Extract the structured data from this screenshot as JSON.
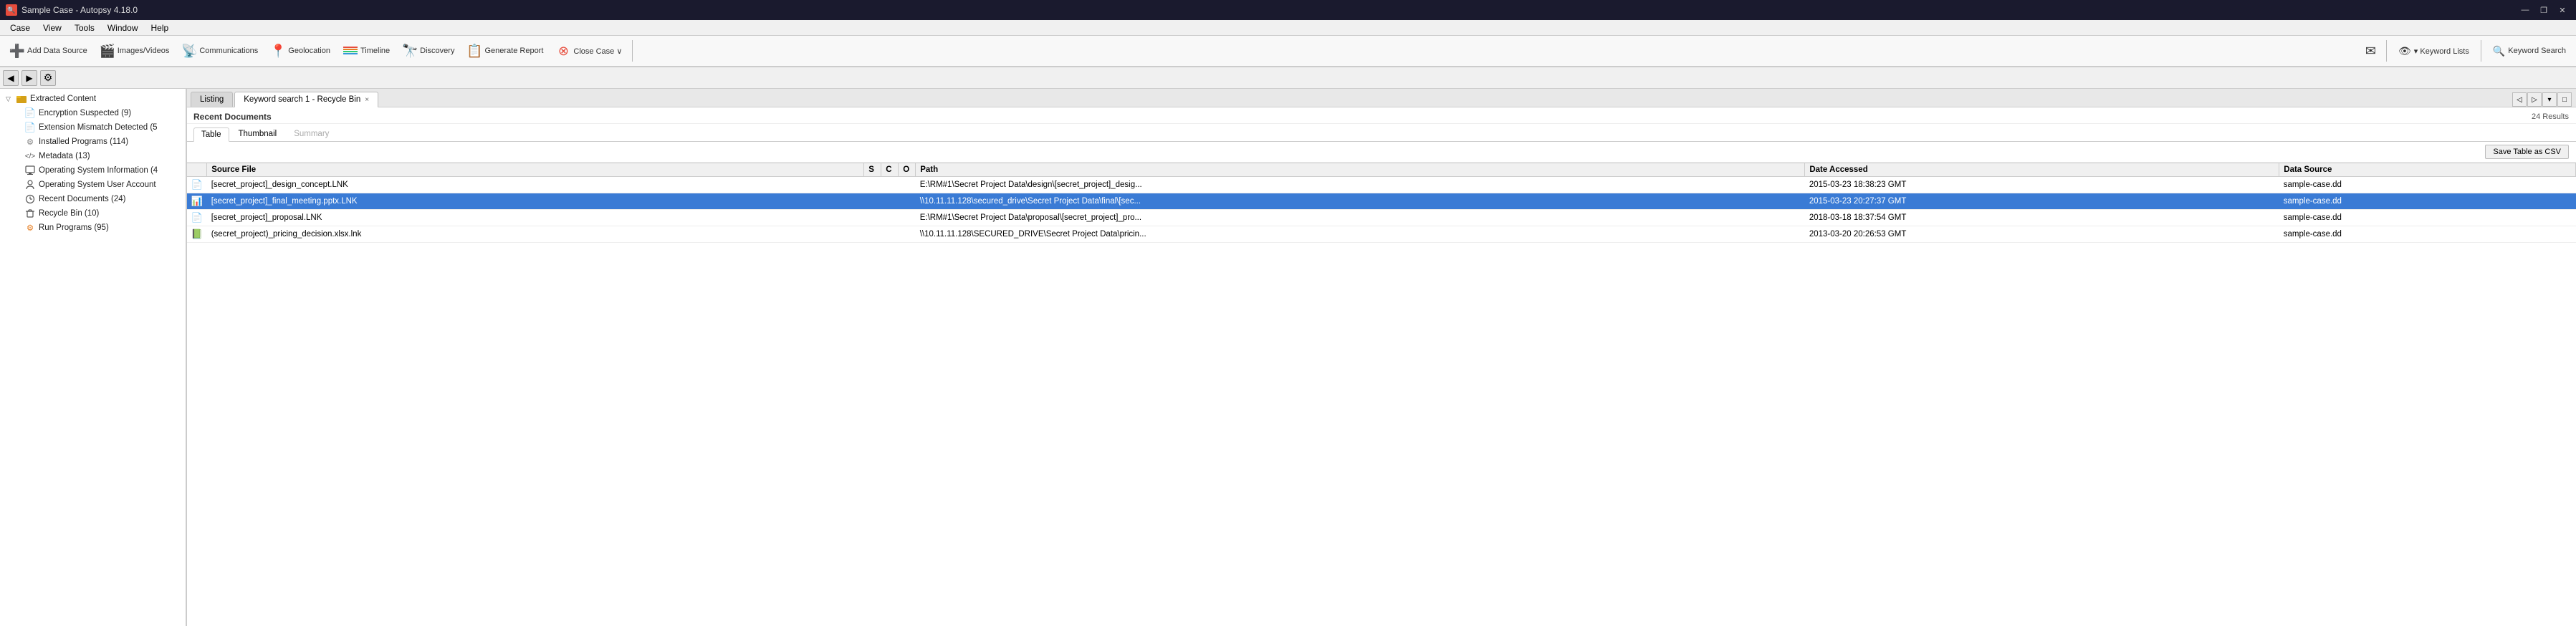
{
  "titleBar": {
    "appName": "Sample Case - Autopsy 4.18.0",
    "icon": "🔍",
    "controls": [
      "—",
      "❐",
      "✕"
    ]
  },
  "menuBar": {
    "items": [
      "Case",
      "View",
      "Tools",
      "Window",
      "Help"
    ]
  },
  "toolbar": {
    "buttons": [
      {
        "id": "add-data-source",
        "label": "Add Data Source",
        "icon": "➕",
        "iconColor": "#2ecc71"
      },
      {
        "id": "images-videos",
        "label": "Images/Videos",
        "icon": "🎬",
        "iconColor": "#3498db"
      },
      {
        "id": "communications",
        "label": "Communications",
        "icon": "📡",
        "iconColor": "#9b59b6"
      },
      {
        "id": "geolocation",
        "label": "Geolocation",
        "icon": "📍",
        "iconColor": "#e74c3c"
      },
      {
        "id": "timeline",
        "label": "Timeline",
        "icon": "📊",
        "iconColor": "#1abc9c"
      },
      {
        "id": "discovery",
        "label": "Discovery",
        "icon": "🔭",
        "iconColor": "#e67e22"
      },
      {
        "id": "generate-report",
        "label": "Generate Report",
        "icon": "📋",
        "iconColor": "#3498db"
      },
      {
        "id": "close-case",
        "label": "Close Case ∨",
        "icon": "⊗",
        "iconColor": "#e74c3c"
      }
    ],
    "rightButtons": [
      {
        "id": "keyword-lists",
        "label": "▾ Keyword Lists",
        "icon": "👁"
      },
      {
        "id": "keyword-search",
        "label": "Keyword Search",
        "icon": "🔍"
      }
    ]
  },
  "navBar": {
    "backLabel": "◀",
    "forwardLabel": "▶",
    "gearLabel": "⚙"
  },
  "tabs": {
    "listing": "Listing",
    "keywordSearch": "Keyword search 1 - Recycle Bin",
    "closeBtn": "×"
  },
  "contentHeader": {
    "sectionTitle": "Recent Documents",
    "resultsCount": "24 Results"
  },
  "subTabs": [
    "Table",
    "Thumbnail",
    "Summary"
  ],
  "activeSubTab": "Table",
  "saveCSVLabel": "Save Table as CSV",
  "tableHeaders": [
    {
      "id": "source-file",
      "label": "Source File"
    },
    {
      "id": "s-col",
      "label": "S"
    },
    {
      "id": "c-col",
      "label": "C"
    },
    {
      "id": "o-col",
      "label": "O"
    },
    {
      "id": "path",
      "label": "Path"
    },
    {
      "id": "date-accessed",
      "label": "Date Accessed"
    },
    {
      "id": "data-source",
      "label": "Data Source"
    }
  ],
  "tableRows": [
    {
      "id": 1,
      "iconType": "doc",
      "sourceFile": "[secret_project]_design_concept.LNK",
      "s": "",
      "c": "",
      "o": "",
      "path": "E:\\RM#1\\Secret Project Data\\design\\[secret_project]_desig...",
      "dateAccessed": "2015-03-23 18:38:23 GMT",
      "dataSource": "sample-case.dd",
      "selected": false
    },
    {
      "id": 2,
      "iconType": "pptx",
      "sourceFile": "[secret_project]_final_meeting.pptx.LNK",
      "s": "",
      "c": "",
      "o": "",
      "path": "\\\\10.11.11.128\\secured_drive\\Secret Project Data\\final\\[sec...",
      "dateAccessed": "2015-03-23 20:27:37 GMT",
      "dataSource": "sample-case.dd",
      "selected": true
    },
    {
      "id": 3,
      "iconType": "doc",
      "sourceFile": "[secret_project]_proposal.LNK",
      "s": "",
      "c": "",
      "o": "",
      "path": "E:\\RM#1\\Secret Project Data\\proposal\\[secret_project]_pro...",
      "dateAccessed": "2018-03-18 18:37:54 GMT",
      "dataSource": "sample-case.dd",
      "selected": false
    },
    {
      "id": 4,
      "iconType": "xlsx",
      "sourceFile": "(secret_project)_pricing_decision.xlsx.lnk",
      "s": "",
      "c": "",
      "o": "",
      "path": "\\\\10.11.11.128\\SECURED_DRIVE\\Secret Project Data\\pricin...",
      "dateAccessed": "2013-03-20 20:26:53 GMT",
      "dataSource": "sample-case.dd",
      "selected": false
    }
  ],
  "sidebar": {
    "rootLabel": "Extracted Content",
    "items": [
      {
        "id": "encryption-suspected",
        "label": "Encryption Suspected (9)",
        "iconType": "doc",
        "indent": 1
      },
      {
        "id": "extension-mismatch",
        "label": "Extension Mismatch Detected (5",
        "iconType": "doc",
        "indent": 1
      },
      {
        "id": "installed-programs",
        "label": "Installed Programs (114)",
        "iconType": "gear",
        "indent": 1
      },
      {
        "id": "metadata",
        "label": "Metadata (13)",
        "iconType": "code",
        "indent": 1
      },
      {
        "id": "os-info",
        "label": "Operating System Information (4",
        "iconType": "monitor",
        "indent": 1
      },
      {
        "id": "os-user-account",
        "label": "Operating System User Account",
        "iconType": "person",
        "indent": 1
      },
      {
        "id": "recent-documents",
        "label": "Recent Documents (24)",
        "iconType": "clock",
        "indent": 1
      },
      {
        "id": "recycle-bin",
        "label": "Recycle Bin (10)",
        "iconType": "trash",
        "indent": 1
      },
      {
        "id": "run-programs",
        "label": "Run Programs (95)",
        "iconType": "gear2",
        "indent": 1
      }
    ]
  },
  "icons": {
    "doc": "📄",
    "pptx": "📊",
    "xlsx": "📗",
    "gear": "⚙",
    "code": "</>",
    "monitor": "🖥",
    "person": "👤",
    "clock": "🕐",
    "trash": "🗑",
    "gear2": "⚙"
  }
}
